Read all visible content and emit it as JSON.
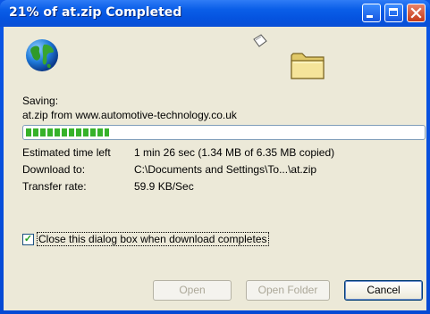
{
  "window": {
    "title": "21% of at.zip Completed",
    "colors": {
      "titlebar": "#0a5ee8",
      "client": "#ece9d8",
      "progress": "#37b22a"
    }
  },
  "status": {
    "saving_label": "Saving:",
    "source": "at.zip from www.automotive-technology.co.uk",
    "progress": 0.21
  },
  "details": {
    "time_left_label": "Estimated time left",
    "time_left_value": "1 min 26 sec (1.34 MB of 6.35 MB copied)",
    "download_to_label": "Download to:",
    "download_to_value": "C:\\Documents and Settings\\To...\\at.zip",
    "transfer_rate_label": "Transfer rate:",
    "transfer_rate_value": "59.9 KB/Sec"
  },
  "checkbox": {
    "label": "Close this dialog box when download completes",
    "checked": true
  },
  "buttons": {
    "open": "Open",
    "open_folder": "Open Folder",
    "cancel": "Cancel"
  },
  "icons": [
    "globe-icon",
    "paper-icon",
    "folder-icon",
    "minimize-icon",
    "maximize-icon",
    "close-icon"
  ]
}
